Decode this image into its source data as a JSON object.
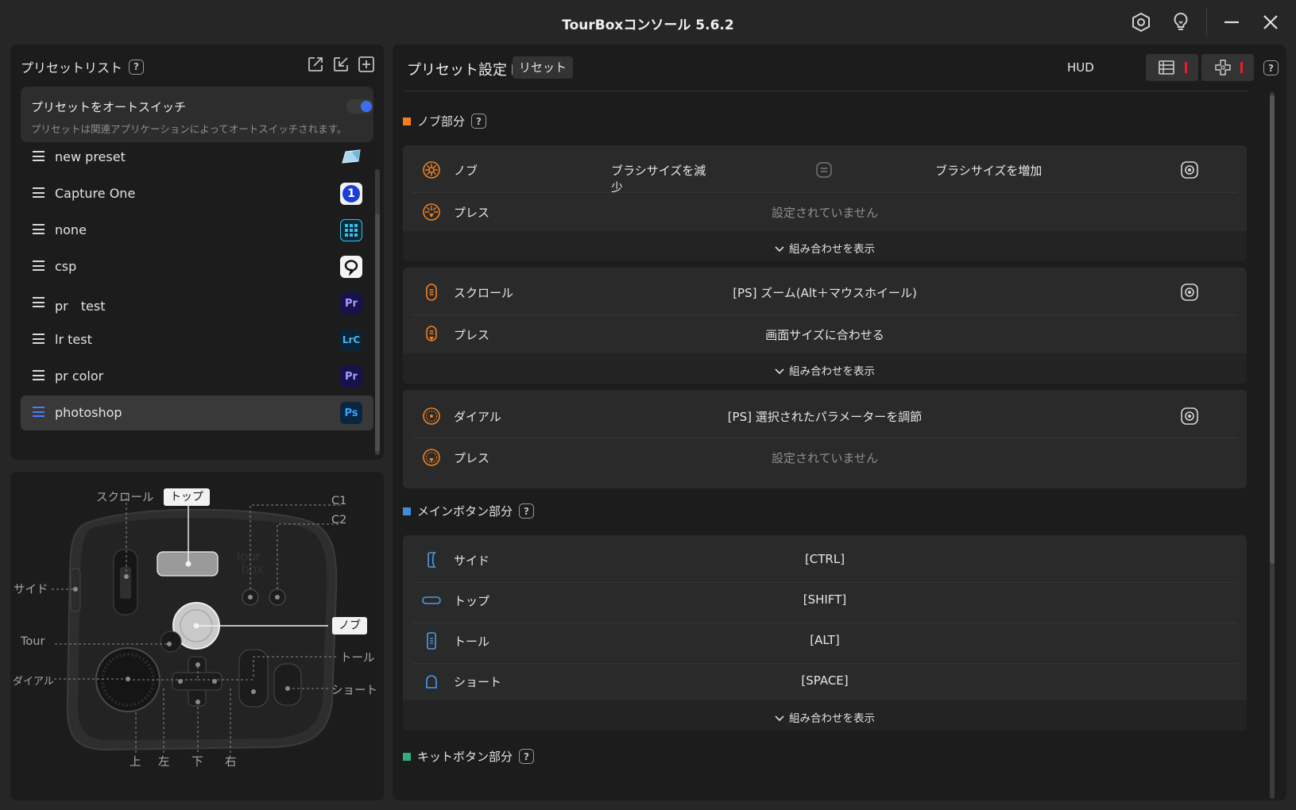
{
  "window": {
    "title": "TourBoxコンソール 5.6.2"
  },
  "sidebar": {
    "title": "プリセットリスト",
    "auto_switch": {
      "title": "プリセットをオートスイッチ",
      "description": "プリセットは関連アプリケーションによってオートスイッチされます。",
      "enabled": true
    },
    "presets": [
      {
        "name": "new preset",
        "app_icon": "monitor-app-icon"
      },
      {
        "name": "Capture One",
        "app_icon": "capture-one-icon",
        "app_text": "1"
      },
      {
        "name": "none",
        "app_icon": "grid-app-icon"
      },
      {
        "name": "csp",
        "app_icon": "clip-studio-icon"
      },
      {
        "name": "pr　test",
        "app_icon": "premiere-icon",
        "app_text": "Pr"
      },
      {
        "name": "lr test",
        "app_icon": "lightroom-classic-icon",
        "app_text": "LrC"
      },
      {
        "name": "pr color",
        "app_icon": "premiere-icon",
        "app_text": "Pr"
      },
      {
        "name": "photoshop",
        "app_icon": "photoshop-icon",
        "app_text": "Ps",
        "selected": true
      }
    ]
  },
  "device": {
    "labels": {
      "scroll": "スクロール",
      "top": "トップ",
      "c1": "C1",
      "c2": "C2",
      "side": "サイド",
      "knob": "ノブ",
      "tour": "Tour",
      "tall": "トール",
      "dial": "ダイアル",
      "short": "ショート",
      "up": "上",
      "left": "左",
      "down": "下",
      "right": "右"
    }
  },
  "main": {
    "title": "プリセット設定",
    "reset_label": "リセット",
    "hud_label": "HUD",
    "show_combos": "組み合わせを表示",
    "sections": {
      "knob_section": {
        "title": "ノブ部分",
        "color": "#f07f22",
        "groups": {
          "knob": {
            "rotate": {
              "name": "ノブ",
              "left": "ブラシサイズを減少",
              "right": "ブラシサイズを増加"
            },
            "press": {
              "name": "プレス",
              "value": "設定されていません"
            }
          },
          "scroll": {
            "rotate": {
              "name": "スクロール",
              "value": "[PS] ズーム(Alt＋マウスホイール)"
            },
            "press": {
              "name": "プレス",
              "value": "画面サイズに合わせる"
            }
          },
          "dial": {
            "rotate": {
              "name": "ダイアル",
              "value": "[PS] 選択されたパラメーターを調節"
            },
            "press": {
              "name": "プレス",
              "value": "設定されていません"
            }
          }
        }
      },
      "main_buttons": {
        "title": "メインボタン部分",
        "color": "#3f8fd8",
        "rows": [
          {
            "name": "サイド",
            "value": "[CTRL]",
            "icon": "side-button-icon"
          },
          {
            "name": "トップ",
            "value": "[SHIFT]",
            "icon": "top-button-icon"
          },
          {
            "name": "トール",
            "value": "[ALT]",
            "icon": "tall-button-icon"
          },
          {
            "name": "ショート",
            "value": "[SPACE]",
            "icon": "short-button-icon"
          }
        ]
      },
      "kit_buttons": {
        "title": "キットボタン部分",
        "color": "#2fb07b"
      }
    }
  }
}
